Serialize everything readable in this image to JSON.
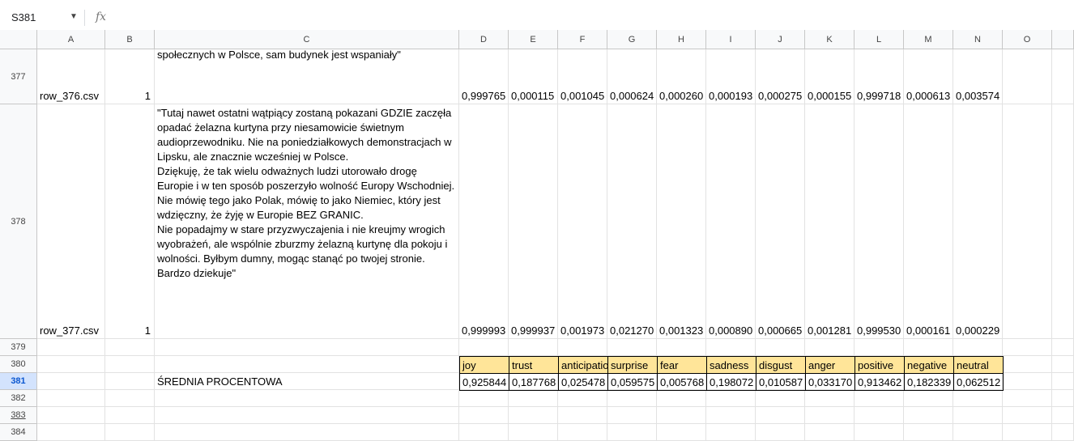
{
  "namebox": "S381",
  "fx": "fx",
  "columns": [
    "A",
    "B",
    "C",
    "D",
    "E",
    "F",
    "G",
    "H",
    "I",
    "J",
    "K",
    "L",
    "M",
    "N",
    "O"
  ],
  "rows": [
    "377",
    "378",
    "379",
    "380",
    "381",
    "382",
    "383",
    "384"
  ],
  "r377": {
    "c_text": "społecznych w Polsce, sam budynek jest wspaniały\"",
    "a": "row_376.csv",
    "b": "1",
    "values": [
      "0,999765",
      "0,000115",
      "0,001045",
      "0,000624",
      "0,000260",
      "0,000193",
      "0,000275",
      "0,000155",
      "0,999718",
      "0,000613",
      "0,003574"
    ]
  },
  "r378": {
    "c_text": "\"Tutaj nawet ostatni wątpiący zostaną pokazani GDZIE zaczęła opadać żelazna kurtyna przy niesamowicie świetnym audioprzewodniku. Nie na poniedziałkowych demonstracjach w Lipsku, ale znacznie wcześniej w Polsce.\nDziękuję, że tak wielu odważnych ludzi utorowało drogę Europie i w ten sposób poszerzyło wolność Europy Wschodniej.\nNie mówię tego jako Polak, mówię to jako Niemiec, który jest wdzięczny, że żyję w Europie BEZ GRANIC.\nNie popadajmy w stare przyzwyczajenia i nie kreujmy wrogich wyobrażeń, ale wspólnie zburzmy żelazną kurtynę dla pokoju i wolności. Byłbym dumny, mogąc stanąć po twojej stronie. Bardzo dziekuje\"",
    "a": "row_377.csv",
    "b": "1",
    "values": [
      "0,999993",
      "0,999937",
      "0,001973",
      "0,021270",
      "0,001323",
      "0,000890",
      "0,000665",
      "0,001281",
      "0,999530",
      "0,000161",
      "0,000229"
    ]
  },
  "r380": {
    "labels": [
      "joy",
      "trust",
      "anticipation",
      "surprise",
      "fear",
      "sadness",
      "disgust",
      "anger",
      "positive",
      "negative",
      "neutral"
    ]
  },
  "r381": {
    "label": "ŚREDNIA PROCENTOWA",
    "values": [
      "0,925844",
      "0,187768",
      "0,025478",
      "0,059575",
      "0,005768",
      "0,198072",
      "0,010587",
      "0,033170",
      "0,913462",
      "0,182339",
      "0,062512"
    ]
  }
}
